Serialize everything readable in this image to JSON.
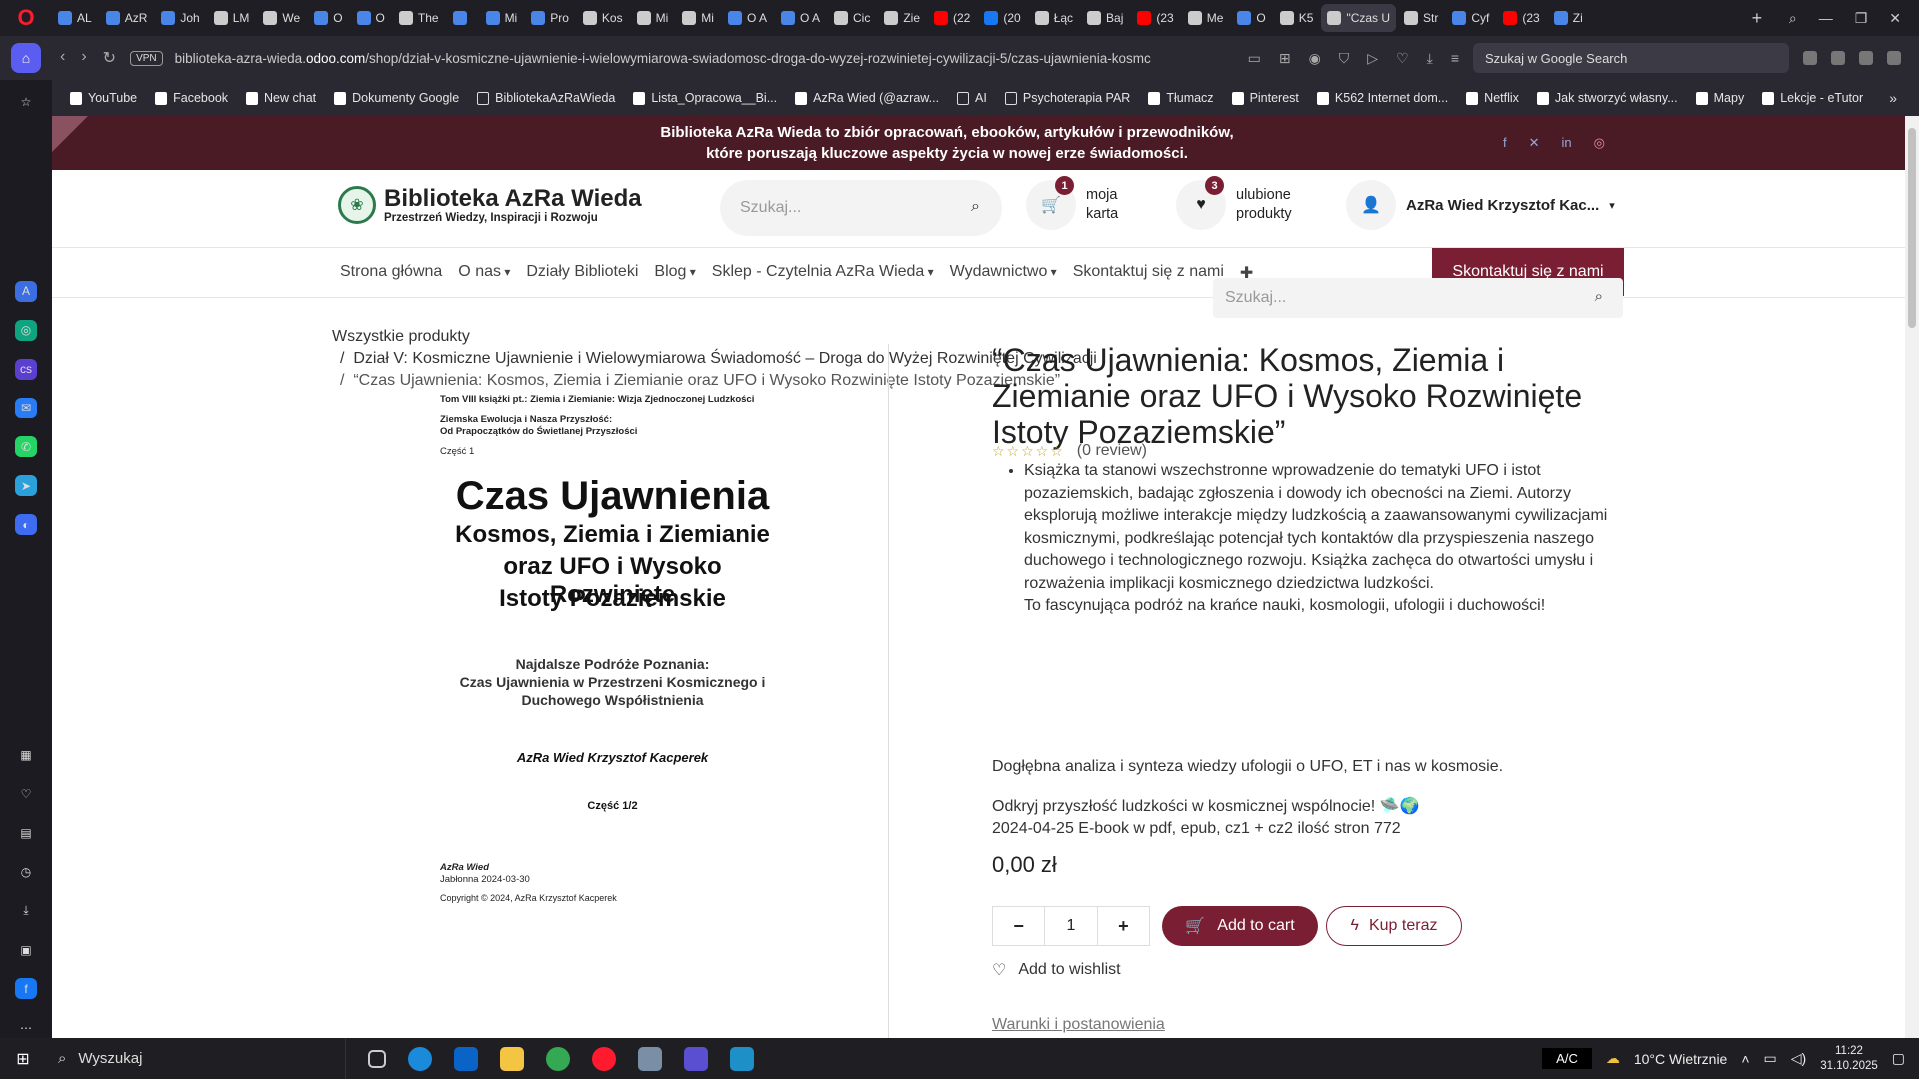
{
  "browser": {
    "tabs": [
      {
        "label": "AL",
        "icon": "doc"
      },
      {
        "label": "AzR",
        "icon": "doc"
      },
      {
        "label": "Joh",
        "icon": "doc"
      },
      {
        "label": "LM",
        "icon": "gen"
      },
      {
        "label": "We",
        "icon": "gen"
      },
      {
        "label": "O",
        "icon": "doc"
      },
      {
        "label": "O",
        "icon": "doc"
      },
      {
        "label": "The",
        "icon": "gen"
      },
      {
        "label": "",
        "icon": "doc"
      },
      {
        "label": "Mi",
        "icon": "doc"
      },
      {
        "label": "Pro",
        "icon": "doc"
      },
      {
        "label": "Kos",
        "icon": "gen"
      },
      {
        "label": "Mi",
        "icon": "gen"
      },
      {
        "label": "Mi",
        "icon": "gen"
      },
      {
        "label": "O A",
        "icon": "doc"
      },
      {
        "label": "O A",
        "icon": "doc"
      },
      {
        "label": "Cic",
        "icon": "gen"
      },
      {
        "label": "Zie",
        "icon": "gen"
      },
      {
        "label": "(22",
        "icon": "yt"
      },
      {
        "label": "(20",
        "icon": "fb"
      },
      {
        "label": "Łąc",
        "icon": "gen"
      },
      {
        "label": "Baj",
        "icon": "gen"
      },
      {
        "label": "(23",
        "icon": "yt"
      },
      {
        "label": "Me",
        "icon": "gen"
      },
      {
        "label": "O",
        "icon": "doc"
      },
      {
        "label": "K5",
        "icon": "gen"
      },
      {
        "label": "\"Czas U",
        "icon": "gen",
        "active": true
      },
      {
        "label": "Str",
        "icon": "gen"
      },
      {
        "label": "Cyf",
        "icon": "doc"
      },
      {
        "label": "(23",
        "icon": "yt"
      },
      {
        "label": "Zi",
        "icon": "doc"
      }
    ],
    "url_prefix": "biblioteka-azra-wieda.",
    "url_domain": "odoo.com",
    "url_path": "/shop/dział-v-kosmiczne-ujawnienie-i-wielowymiarowa-swiadomosc-droga-do-wyzej-rozwinietej-cywilizacji-5/czas-ujawnienia-kosmc",
    "vpn": "VPN",
    "google_search_placeholder": "Szukaj w Google Search",
    "bookmarks": [
      {
        "label": "YouTube",
        "type": "link"
      },
      {
        "label": "Facebook",
        "type": "link"
      },
      {
        "label": "New chat",
        "type": "link"
      },
      {
        "label": "Dokumenty Google",
        "type": "link"
      },
      {
        "label": "BibliotekaAzRaWieda",
        "type": "folder"
      },
      {
        "label": "Lista_Opracowa__Bi...",
        "type": "link"
      },
      {
        "label": "AzRa Wied (@azraw...",
        "type": "link"
      },
      {
        "label": "AI",
        "type": "folder"
      },
      {
        "label": "Psychoterapia PAR",
        "type": "folder"
      },
      {
        "label": "Tłumacz",
        "type": "link"
      },
      {
        "label": "Pinterest",
        "type": "link"
      },
      {
        "label": "K562 Internet dom...",
        "type": "link"
      },
      {
        "label": "Netflix",
        "type": "link"
      },
      {
        "label": "Jak stworzyć własny...",
        "type": "link"
      },
      {
        "label": "Mapy",
        "type": "link"
      },
      {
        "label": "Lekcje - eTutor",
        "type": "link"
      }
    ]
  },
  "announcement": {
    "line1": "Biblioteka AzRa Wieda to zbiór opracowań, ebooków, artykułów i przewodników,",
    "line2": "które poruszają kluczowe aspekty życia w nowej erze świadomości."
  },
  "header": {
    "logo_title": "Biblioteka AzRa Wieda",
    "logo_subtitle": "Przestrzeń Wiedzy, Inspiracji i Rozwoju",
    "search_placeholder": "Szukaj...",
    "cart_count": "1",
    "cart_label_1": "moja",
    "cart_label_2": "karta",
    "wishlist_count": "3",
    "wishlist_label_1": "ulubione",
    "wishlist_label_2": "produkty",
    "user_name": "AzRa Wied Krzysztof Kac..."
  },
  "nav": {
    "items": [
      "Strona główna",
      "O nas",
      "Działy Biblioteki",
      "Blog",
      "Sklep - Czytelnia AzRa Wieda",
      "Wydawnictwo",
      "Skontaktuj się z nami"
    ],
    "contact_button": "Skontaktuj się z nami"
  },
  "breadcrumb": {
    "root": "Wszystkie produkty",
    "category": "Dział V: Kosmiczne Ujawnienie i Wielowymiarowa Świadomość – Droga do Wyżej Rozwiniętej Cywilizacji",
    "current": "“Czas Ujawnienia: Kosmos, Ziemia i Ziemianie oraz UFO i Wysoko Rozwinięte Istoty Pozaziemskie”",
    "search_placeholder": "Szukaj..."
  },
  "cover": {
    "volume": "Tom VIII książki pt.: Ziemia i Ziemianie: Wizja Zjednoczonej Ludzkości",
    "series_1": "Ziemska Ewolucja i Nasza Przyszłość:",
    "series_2": "Od Prapoczątków do Świetlanej Przyszłości",
    "part": "Część 1",
    "title": "Czas Ujawnienia",
    "subtitle_1": "Kosmos, Ziemia i Ziemianie",
    "subtitle_2": "oraz UFO i Wysoko Rozwinięte",
    "subtitle_3": "Istoty Pozaziemskie",
    "tagline_1": "Najdalsze Podróże Poznania:",
    "tagline_2": "Czas Ujawnienia w Przestrzeni Kosmicznego i",
    "tagline_3": "Duchowego Współistnienia",
    "author": "AzRa Wied Krzysztof Kacperek",
    "part_label": "Część 1/2",
    "publisher": "AzRa Wied",
    "place_date": "Jabłonna 2024-03-30",
    "copyright": "Copyright © 2024, AzRa Krzysztof Kacperek"
  },
  "product": {
    "title": "“Czas Ujawnienia: Kosmos, Ziemia i Ziemianie oraz UFO i Wysoko Rozwinięte Istoty Pozaziemskie”",
    "stars": "☆☆☆☆☆",
    "review_count": "(0 review)",
    "description": "Książka ta stanowi wszechstronne wprowadzenie do tematyki UFO i istot pozaziemskich, badając zgłoszenia i dowody ich obecności na Ziemi. Autorzy eksplorują możliwe interakcje między ludzkością a zaawansowanymi cywilizacjami kosmicznymi, podkreślając potencjał tych kontaktów dla przyspieszenia naszego duchowego i technologicznego rozwoju. Książka zachęca do otwartości umysłu i rozważenia implikacji kosmicznego dziedzictwa ludzkości.",
    "description_2": "To fascynująca podróż na krańce nauki, kosmologii, ufologii i duchowości!",
    "analysis": "Dogłębna analiza i synteza wiedzy ufologii o UFO, ET i nas w kosmosie.",
    "discover": "Odkryj przyszłość ludzkości w kosmicznej wspólnocie! 🛸🌍",
    "details": "2024-04-25 E-book w pdf, epub, cz1 + cz2  ilość stron 772",
    "price": "0,00 zł",
    "quantity": "1",
    "add_to_cart": "Add to cart",
    "buy_now": "Kup teraz",
    "wishlist": "Add to wishlist",
    "terms": "Warunki i postanowienia"
  },
  "taskbar": {
    "search_placeholder": "Wyszukaj",
    "ac": "A/C",
    "weather": "10°C  Wietrznie",
    "time": "11:22",
    "date": "31.10.2025"
  },
  "colors": {
    "brand": "#7a1e33",
    "announce_bg": "#4a1a25"
  }
}
